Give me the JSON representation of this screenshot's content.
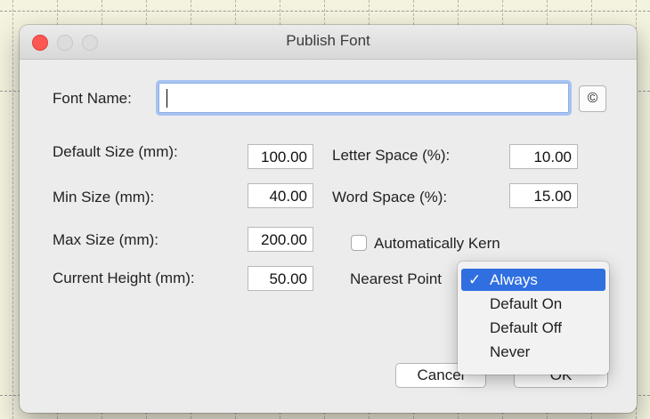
{
  "window": {
    "title": "Publish Font"
  },
  "font_name": {
    "label": "Font Name:",
    "value": "",
    "copyright_button": "©"
  },
  "left_fields": [
    {
      "label": "Default Size (mm):",
      "value": "100.00"
    },
    {
      "label": "Min Size (mm):",
      "value": "40.00"
    },
    {
      "label": "Max Size (mm):",
      "value": "200.00"
    },
    {
      "label": "Current Height (mm):",
      "value": "50.00"
    }
  ],
  "right_fields": [
    {
      "label": "Letter Space (%):",
      "value": "10.00"
    },
    {
      "label": "Word Space (%):",
      "value": "15.00"
    }
  ],
  "auto_kern": {
    "label": "Automatically Kern",
    "checked": false
  },
  "nearest_point": {
    "label": "Nearest Point"
  },
  "dropdown": {
    "options": [
      "Always",
      "Default On",
      "Default Off",
      "Never"
    ],
    "selected": "Always",
    "check_glyph": "✓"
  },
  "buttons": {
    "cancel": "Cancel",
    "ok": "OK"
  },
  "colors": {
    "accent": "#2f6fe0",
    "close": "#fc5753",
    "focus_ring": "#a7c3f1"
  }
}
